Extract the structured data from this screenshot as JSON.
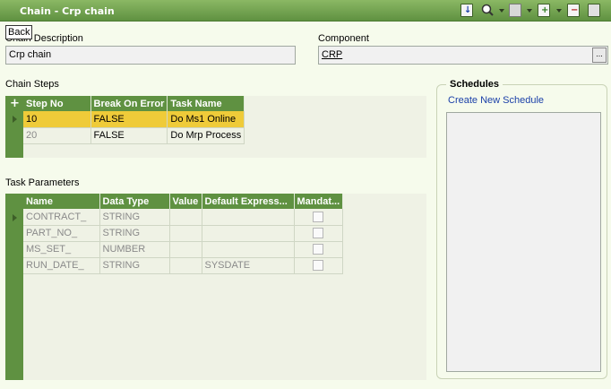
{
  "window": {
    "title": "Chain - Crp chain"
  },
  "back_label": "Back",
  "header": {
    "chain_description_label": "Chain Description",
    "chain_description_value": "Crp chain",
    "component_label": "Component",
    "component_value": "CRP",
    "lov_label": "..."
  },
  "chain_steps": {
    "title": "Chain Steps",
    "add_glyph": "+",
    "columns": [
      "Step No",
      "Break On Error",
      "Task Name"
    ],
    "rows": [
      {
        "step_no": "10",
        "break_on_error": "FALSE",
        "task_name": "Do Ms1 Online"
      },
      {
        "step_no": "20",
        "break_on_error": "FALSE",
        "task_name": "Do Mrp Process"
      }
    ]
  },
  "task_parameters": {
    "title": "Task Parameters",
    "columns": [
      "Name",
      "Data Type",
      "Value",
      "Default  Express...",
      "Mandat..."
    ],
    "rows": [
      {
        "name": "CONTRACT_",
        "data_type": "STRING",
        "value": "",
        "default": ""
      },
      {
        "name": "PART_NO_",
        "data_type": "STRING",
        "value": "",
        "default": ""
      },
      {
        "name": "MS_SET_",
        "data_type": "NUMBER",
        "value": "",
        "default": ""
      },
      {
        "name": "RUN_DATE_",
        "data_type": "STRING",
        "value": "",
        "default": "SYSDATE"
      }
    ]
  },
  "schedules": {
    "title": "Schedules",
    "create_link": "Create New Schedule"
  },
  "colors": {
    "title_bar": "#5f9141",
    "selected_row": "#efcb39",
    "link": "#1a3fa8",
    "background": "#f6fbec"
  },
  "toolbar_icons": [
    "save-down-icon",
    "search-icon",
    "print-icon",
    "new-record-icon",
    "delete-record-icon",
    "details-icon"
  ]
}
